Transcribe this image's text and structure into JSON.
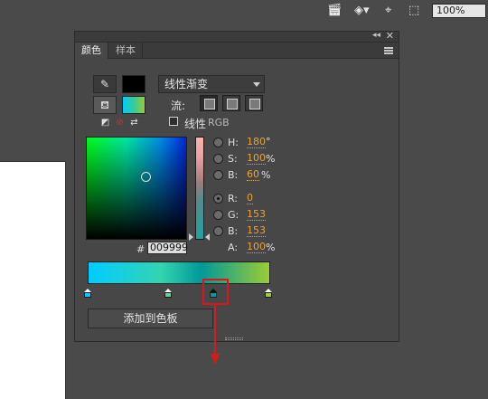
{
  "toolbar": {
    "icons": [
      "movie-clip-icon",
      "camera-icon",
      "crosshair-icon",
      "crop-frame-icon"
    ],
    "zoom": "100%"
  },
  "panel": {
    "tabs": [
      {
        "label": "颜色",
        "active": true
      },
      {
        "label": "样本",
        "active": false
      }
    ],
    "collapse_glyph": "◂◂",
    "close_glyph": "✕",
    "fill_type": "线性渐变",
    "flow_label": "流:",
    "linear_rgb_label": "线性",
    "rgb_label": "RGB",
    "hex_hash": "#",
    "hex_value": "009999",
    "hsb": [
      {
        "label": "H:",
        "value": "180",
        "unit": "°",
        "checked": false
      },
      {
        "label": "S:",
        "value": "100",
        "unit": "%",
        "checked": false
      },
      {
        "label": "B:",
        "value": "60",
        "unit": "%",
        "checked": false
      }
    ],
    "rgb": [
      {
        "label": "R:",
        "value": "0",
        "checked": true
      },
      {
        "label": "G:",
        "value": "153",
        "checked": false
      },
      {
        "label": "B:",
        "value": "153",
        "checked": false
      }
    ],
    "alpha": {
      "label": "A:",
      "value": "100",
      "unit": "%"
    },
    "gradient_stops": [
      {
        "color": "#00ccff",
        "position": 0.0,
        "selected": false
      },
      {
        "color": "#66cc99",
        "position": 0.44,
        "selected": false
      },
      {
        "color": "#009999",
        "position": 0.69,
        "selected": true
      },
      {
        "color": "#99cc33",
        "position": 0.99,
        "selected": false
      }
    ],
    "add_button": "添加到色板"
  },
  "colors": {
    "current_fill": "#009999",
    "stroke_swatch": "#000000",
    "highlight": "#e0121b"
  }
}
